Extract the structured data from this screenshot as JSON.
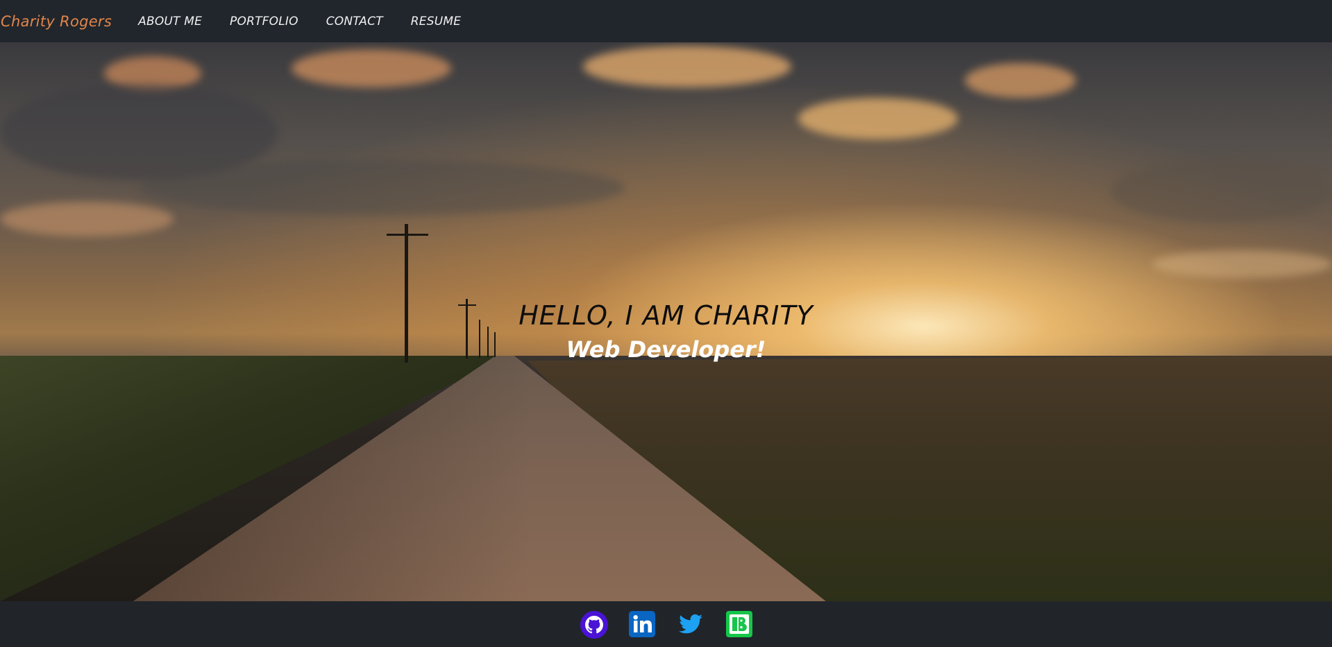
{
  "nav": {
    "brand": "Charity Rogers",
    "links": [
      "ABOUT ME",
      "PORTFOLIO",
      "CONTACT",
      "RESUME"
    ]
  },
  "hero": {
    "title": "HELLO, I AM CHARITY",
    "subtitle": "Web Developer!"
  },
  "footer": {
    "social": [
      {
        "name": "github-icon",
        "color": "#5b1ecf"
      },
      {
        "name": "linkedin-icon",
        "color": "#0a66c2"
      },
      {
        "name": "twitter-icon",
        "color": "#1da1f2"
      },
      {
        "name": "bandcamp-icon",
        "color": "#1ecf5a"
      }
    ]
  },
  "colors": {
    "brand": "#e2854a",
    "navbar_bg": "#21262c",
    "footer_bg": "#21252a"
  }
}
